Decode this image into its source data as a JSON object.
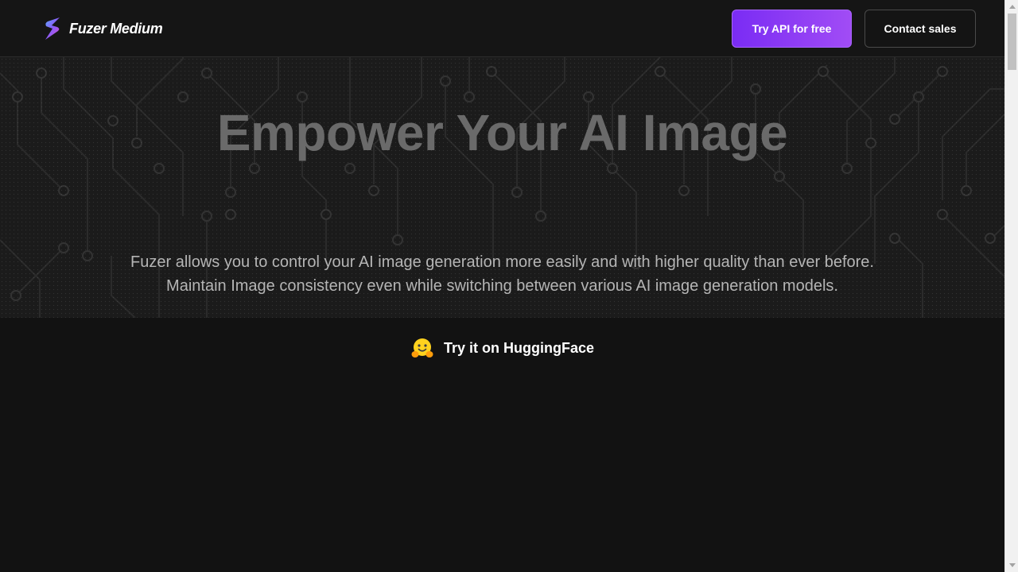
{
  "header": {
    "brand_name": "Fuzer Medium",
    "try_api_label": "Try API for free",
    "contact_sales_label": "Contact sales"
  },
  "hero": {
    "title": "Empower Your AI Image",
    "description_line1": "Fuzer allows you to control your AI image generation more easily and with higher quality than ever before.",
    "description_line2": "Maintain Image consistency even while switching between various AI image generation models."
  },
  "huggingface": {
    "label": "Try it on HuggingFace",
    "icon": "hugging-face-emoji-icon"
  },
  "colors": {
    "background": "#121212",
    "hero_background": "#1b1b1b",
    "accent_start": "#7a2cf4",
    "accent_end": "#a14cf5"
  }
}
